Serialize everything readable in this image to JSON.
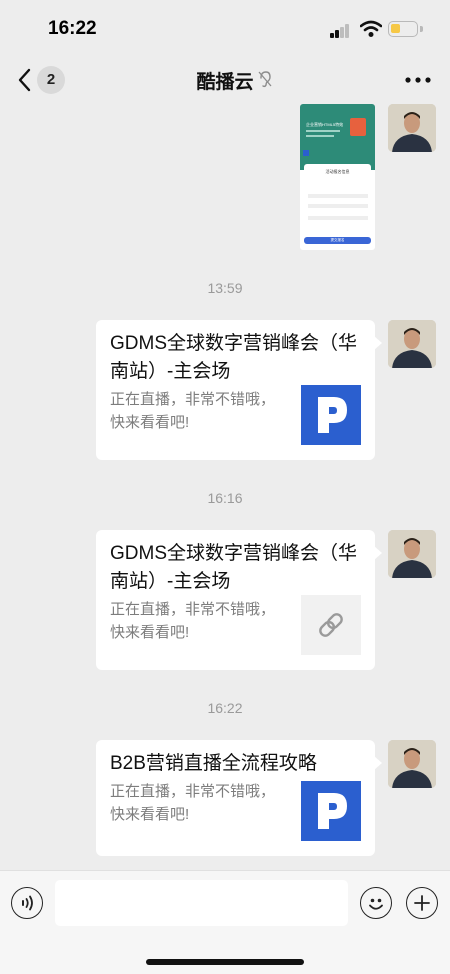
{
  "status_bar": {
    "time": "16:22",
    "battery_color": "#f6c846"
  },
  "nav": {
    "unread_count": "2",
    "title": "酷播云"
  },
  "screenshot_message": {
    "heading": "企业营销HTML5特效",
    "form_title": "活动报名信息",
    "submit_label": "提交报名"
  },
  "messages": [
    {
      "timestamp": "13:59",
      "title": "GDMS全球数字营销峰会（华南站）-主会场",
      "desc": "正在直播，非常不错哦，快来看看吧!",
      "thumb": "logo"
    },
    {
      "timestamp": "16:16",
      "title": "GDMS全球数字营销峰会（华南站）-主会场",
      "desc": "正在直播，非常不错哦，快来看看吧!",
      "thumb": "link-icon"
    },
    {
      "timestamp": "16:22",
      "title": "B2B营销直播全流程攻略",
      "desc": "正在直播，非常不错哦，快来看看吧!",
      "thumb": "logo"
    }
  ],
  "input": {
    "placeholder": ""
  },
  "colors": {
    "background": "#ededed",
    "logo_blue": "#2b5fcf",
    "timestamp": "#9a9a9a"
  }
}
